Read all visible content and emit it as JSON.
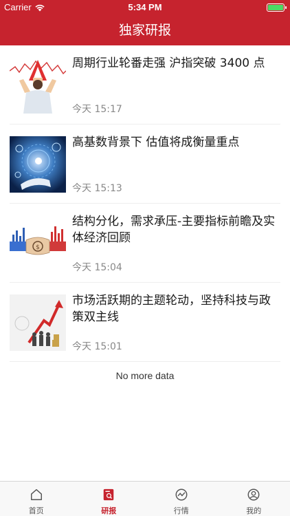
{
  "status_bar": {
    "carrier": "Carrier",
    "time": "5:34 PM"
  },
  "nav": {
    "title": "独家研报"
  },
  "articles": [
    {
      "title": "周期行业轮番走强 沪指突破 3400 点",
      "time": "今天 15:17",
      "thumb": "business-man-chart-thumbnail"
    },
    {
      "title": "高基数背景下 估值将成衡量重点",
      "time": "今天 15:13",
      "thumb": "digital-hand-thumbnail"
    },
    {
      "title": "结构分化，需求承压-主要指标前瞻及实体经济回顾",
      "time": "今天 15:04",
      "thumb": "handshake-chart-thumbnail"
    },
    {
      "title": "市场活跃期的主题轮动，坚持科技与政策双主线",
      "time": "今天 15:01",
      "thumb": "success-arrow-thumbnail"
    }
  ],
  "footer": {
    "no_more": "No more data"
  },
  "tabs": [
    {
      "label": "首页",
      "icon": "home-icon",
      "active": false
    },
    {
      "label": "研报",
      "icon": "report-icon",
      "active": true
    },
    {
      "label": "行情",
      "icon": "market-chart-icon",
      "active": false
    },
    {
      "label": "我的",
      "icon": "profile-icon",
      "active": false
    }
  ],
  "colors": {
    "brand": "#c6232e",
    "battery": "#4cd964",
    "muted_text": "#888888"
  }
}
